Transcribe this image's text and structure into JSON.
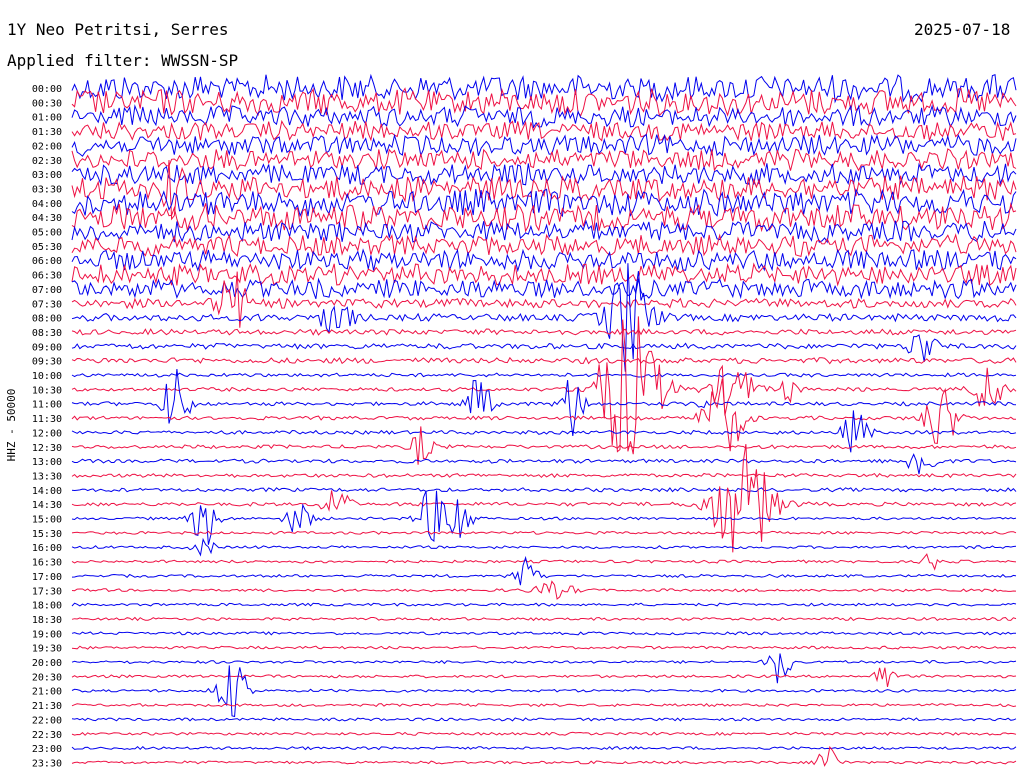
{
  "header": {
    "station": "1Y Neo Petritsi, Serres",
    "date": "2025-07-18",
    "filter": "Applied filter: WWSSN-SP"
  },
  "chart_data": {
    "type": "line",
    "title": "1Y Neo Petritsi, Serres",
    "ylabel": "HHZ - 50000",
    "row_labels": [
      "00:00",
      "00:30",
      "01:00",
      "01:30",
      "02:00",
      "02:30",
      "03:00",
      "03:30",
      "04:00",
      "04:30",
      "05:00",
      "05:30",
      "06:00",
      "06:30",
      "07:00",
      "07:30",
      "08:00",
      "08:30",
      "09:00",
      "09:30",
      "10:00",
      "10:30",
      "11:00",
      "11:30",
      "12:00",
      "12:30",
      "13:00",
      "13:30",
      "14:00",
      "14:30",
      "15:00",
      "15:30",
      "16:00",
      "16:30",
      "17:00",
      "17:30",
      "18:00",
      "18:30",
      "19:00",
      "19:30",
      "20:00",
      "20:30",
      "21:00",
      "21:30",
      "22:00",
      "22:30",
      "23:00",
      "23:30"
    ],
    "colors": [
      "#0000ee",
      "#ee1144"
    ],
    "noise_level": [
      14,
      14,
      11,
      10,
      11,
      11,
      11,
      13,
      14,
      14,
      11,
      11,
      11,
      11,
      10,
      5,
      4,
      3,
      3,
      3,
      2,
      2,
      2,
      2,
      2,
      2,
      2,
      2,
      2,
      2,
      1.5,
      1.5,
      1.5,
      1.5,
      1.5,
      1.5,
      1.5,
      1.5,
      1.5,
      1.5,
      1.5,
      1.5,
      1.5,
      1.5,
      1.5,
      1.5,
      1.5,
      1.5
    ],
    "events": [
      {
        "row": 7,
        "x": 0.11,
        "amp": 30,
        "dur": 0.01
      },
      {
        "row": 15,
        "x": 0.17,
        "amp": 40,
        "dur": 0.012
      },
      {
        "row": 16,
        "x": 0.28,
        "amp": 18,
        "dur": 0.015
      },
      {
        "row": 16,
        "x": 0.59,
        "amp": 60,
        "dur": 0.02
      },
      {
        "row": 18,
        "x": 0.9,
        "amp": 22,
        "dur": 0.012
      },
      {
        "row": 21,
        "x": 0.59,
        "amp": 80,
        "dur": 0.03
      },
      {
        "row": 21,
        "x": 0.7,
        "amp": 30,
        "dur": 0.02
      },
      {
        "row": 21,
        "x": 0.76,
        "amp": 12,
        "dur": 0.01
      },
      {
        "row": 21,
        "x": 0.97,
        "amp": 26,
        "dur": 0.015
      },
      {
        "row": 22,
        "x": 0.11,
        "amp": 40,
        "dur": 0.012
      },
      {
        "row": 22,
        "x": 0.43,
        "amp": 30,
        "dur": 0.012
      },
      {
        "row": 22,
        "x": 0.53,
        "amp": 32,
        "dur": 0.012
      },
      {
        "row": 22,
        "x": 0.67,
        "amp": 8,
        "dur": 0.006
      },
      {
        "row": 23,
        "x": 0.69,
        "amp": 40,
        "dur": 0.02
      },
      {
        "row": 23,
        "x": 0.92,
        "amp": 36,
        "dur": 0.015
      },
      {
        "row": 24,
        "x": 0.83,
        "amp": 24,
        "dur": 0.012
      },
      {
        "row": 25,
        "x": 0.37,
        "amp": 20,
        "dur": 0.01
      },
      {
        "row": 26,
        "x": 0.9,
        "amp": 24,
        "dur": 0.012
      },
      {
        "row": 29,
        "x": 0.28,
        "amp": 22,
        "dur": 0.012
      },
      {
        "row": 29,
        "x": 0.71,
        "amp": 60,
        "dur": 0.03
      },
      {
        "row": 30,
        "x": 0.14,
        "amp": 30,
        "dur": 0.012
      },
      {
        "row": 30,
        "x": 0.24,
        "amp": 18,
        "dur": 0.012
      },
      {
        "row": 30,
        "x": 0.38,
        "amp": 34,
        "dur": 0.012
      },
      {
        "row": 30,
        "x": 0.41,
        "amp": 30,
        "dur": 0.012
      },
      {
        "row": 32,
        "x": 0.14,
        "amp": 10,
        "dur": 0.01
      },
      {
        "row": 33,
        "x": 0.91,
        "amp": 10,
        "dur": 0.008
      },
      {
        "row": 34,
        "x": 0.48,
        "amp": 18,
        "dur": 0.012
      },
      {
        "row": 35,
        "x": 0.51,
        "amp": 8,
        "dur": 0.02
      },
      {
        "row": 40,
        "x": 0.75,
        "amp": 24,
        "dur": 0.01
      },
      {
        "row": 41,
        "x": 0.86,
        "amp": 20,
        "dur": 0.008
      },
      {
        "row": 42,
        "x": 0.17,
        "amp": 30,
        "dur": 0.015
      },
      {
        "row": 47,
        "x": 0.8,
        "amp": 22,
        "dur": 0.01
      }
    ]
  }
}
